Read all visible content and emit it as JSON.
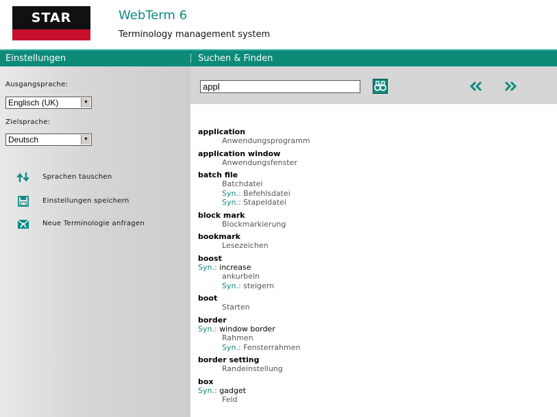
{
  "header": {
    "logo_text": "STAR",
    "title": "WebTerm 6",
    "subtitle": "Terminology management system"
  },
  "band": {
    "left_label": "Einstellungen",
    "right_label": "Suchen & Finden"
  },
  "sidebar": {
    "source_label": "Ausgangsprache:",
    "source_value": "Englisch (UK)",
    "target_label": "Zielsprache:",
    "target_value": "Deutsch",
    "actions": [
      {
        "label": "Sprachen tauschen",
        "icon": "swap-languages-icon"
      },
      {
        "label": "Einstellungen speichern",
        "icon": "save-icon"
      },
      {
        "label": "Neue Terminologie anfragen",
        "icon": "request-terminology-icon"
      }
    ]
  },
  "search": {
    "query": "appl",
    "search_icon": "binoculars-icon",
    "prev_icon": "double-chevron-left-icon",
    "next_icon": "double-chevron-right-icon"
  },
  "syn_label": "Syn.:",
  "results": [
    {
      "term": "application",
      "lines": [
        {
          "text": "Anwendungsprogramm"
        }
      ]
    },
    {
      "term": "application window",
      "lines": [
        {
          "text": "Anwendungsfenster"
        }
      ]
    },
    {
      "term": "batch file",
      "lines": [
        {
          "text": "Batchdatei"
        },
        {
          "syn": true,
          "text": "Befehlsdatei"
        },
        {
          "syn": true,
          "text": "Stapeldatei"
        }
      ]
    },
    {
      "term": "block mark",
      "lines": [
        {
          "text": "Blockmarkierung"
        }
      ]
    },
    {
      "term": "bookmark",
      "lines": [
        {
          "text": "Lesezeichen"
        }
      ]
    },
    {
      "term": "boost",
      "source_syn": "increase",
      "lines": [
        {
          "text": "ankurbeln"
        },
        {
          "syn": true,
          "text": "steigern"
        }
      ]
    },
    {
      "term": "boot",
      "lines": [
        {
          "text": "Starten"
        }
      ]
    },
    {
      "term": "border",
      "source_syn": "window border",
      "lines": [
        {
          "text": "Rahmen"
        },
        {
          "syn": true,
          "text": "Fensterrahmen"
        }
      ]
    },
    {
      "term": "border setting",
      "lines": [
        {
          "text": "Randeinstellung"
        }
      ]
    },
    {
      "term": "box",
      "source_syn": "gadget",
      "lines": [
        {
          "text": "Feld"
        }
      ]
    }
  ],
  "colors": {
    "accent": "#0e8a79",
    "title": "#0e8a82",
    "logo_red": "#c8102e"
  }
}
